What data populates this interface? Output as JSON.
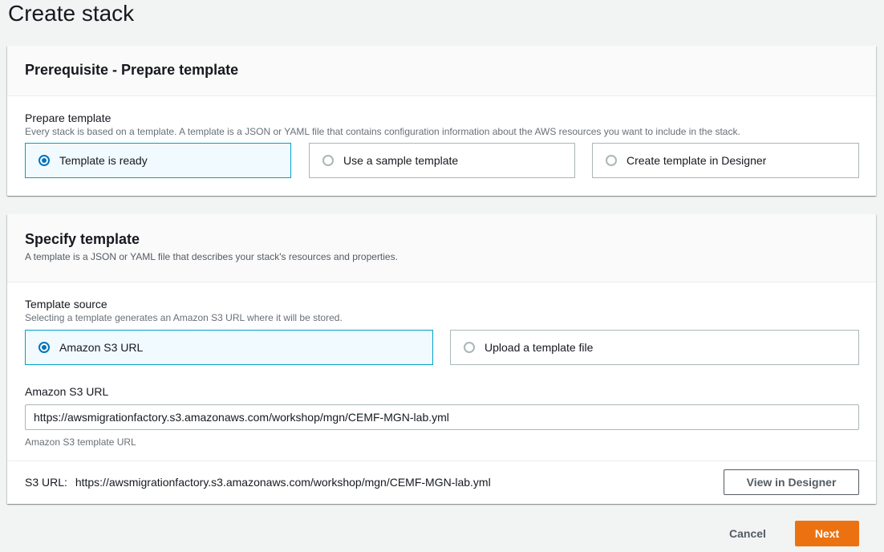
{
  "page": {
    "title": "Create stack"
  },
  "prerequisite": {
    "heading": "Prerequisite - Prepare template",
    "field_label": "Prepare template",
    "field_desc": "Every stack is based on a template. A template is a JSON or YAML file that contains configuration information about the AWS resources you want to include in the stack.",
    "options": [
      {
        "label": "Template is ready",
        "selected": true
      },
      {
        "label": "Use a sample template",
        "selected": false
      },
      {
        "label": "Create template in Designer",
        "selected": false
      }
    ]
  },
  "specify": {
    "heading": "Specify template",
    "desc": "A template is a JSON or YAML file that describes your stack's resources and properties.",
    "source_label": "Template source",
    "source_desc": "Selecting a template generates an Amazon S3 URL where it will be stored.",
    "options": [
      {
        "label": "Amazon S3 URL",
        "selected": true
      },
      {
        "label": "Upload a template file",
        "selected": false
      }
    ],
    "url_label": "Amazon S3 URL",
    "url_value": "https://awsmigrationfactory.s3.amazonaws.com/workshop/mgn/CEMF-MGN-lab.yml",
    "url_hint": "Amazon S3 template URL",
    "s3_url_label": "S3 URL:",
    "s3_url_value": "https://awsmigrationfactory.s3.amazonaws.com/workshop/mgn/CEMF-MGN-lab.yml",
    "view_designer_label": "View in Designer"
  },
  "actions": {
    "cancel_label": "Cancel",
    "next_label": "Next"
  },
  "colors": {
    "accent": "#0073bb",
    "selected_border": "#00a1c9",
    "primary_button": "#ec7211"
  }
}
